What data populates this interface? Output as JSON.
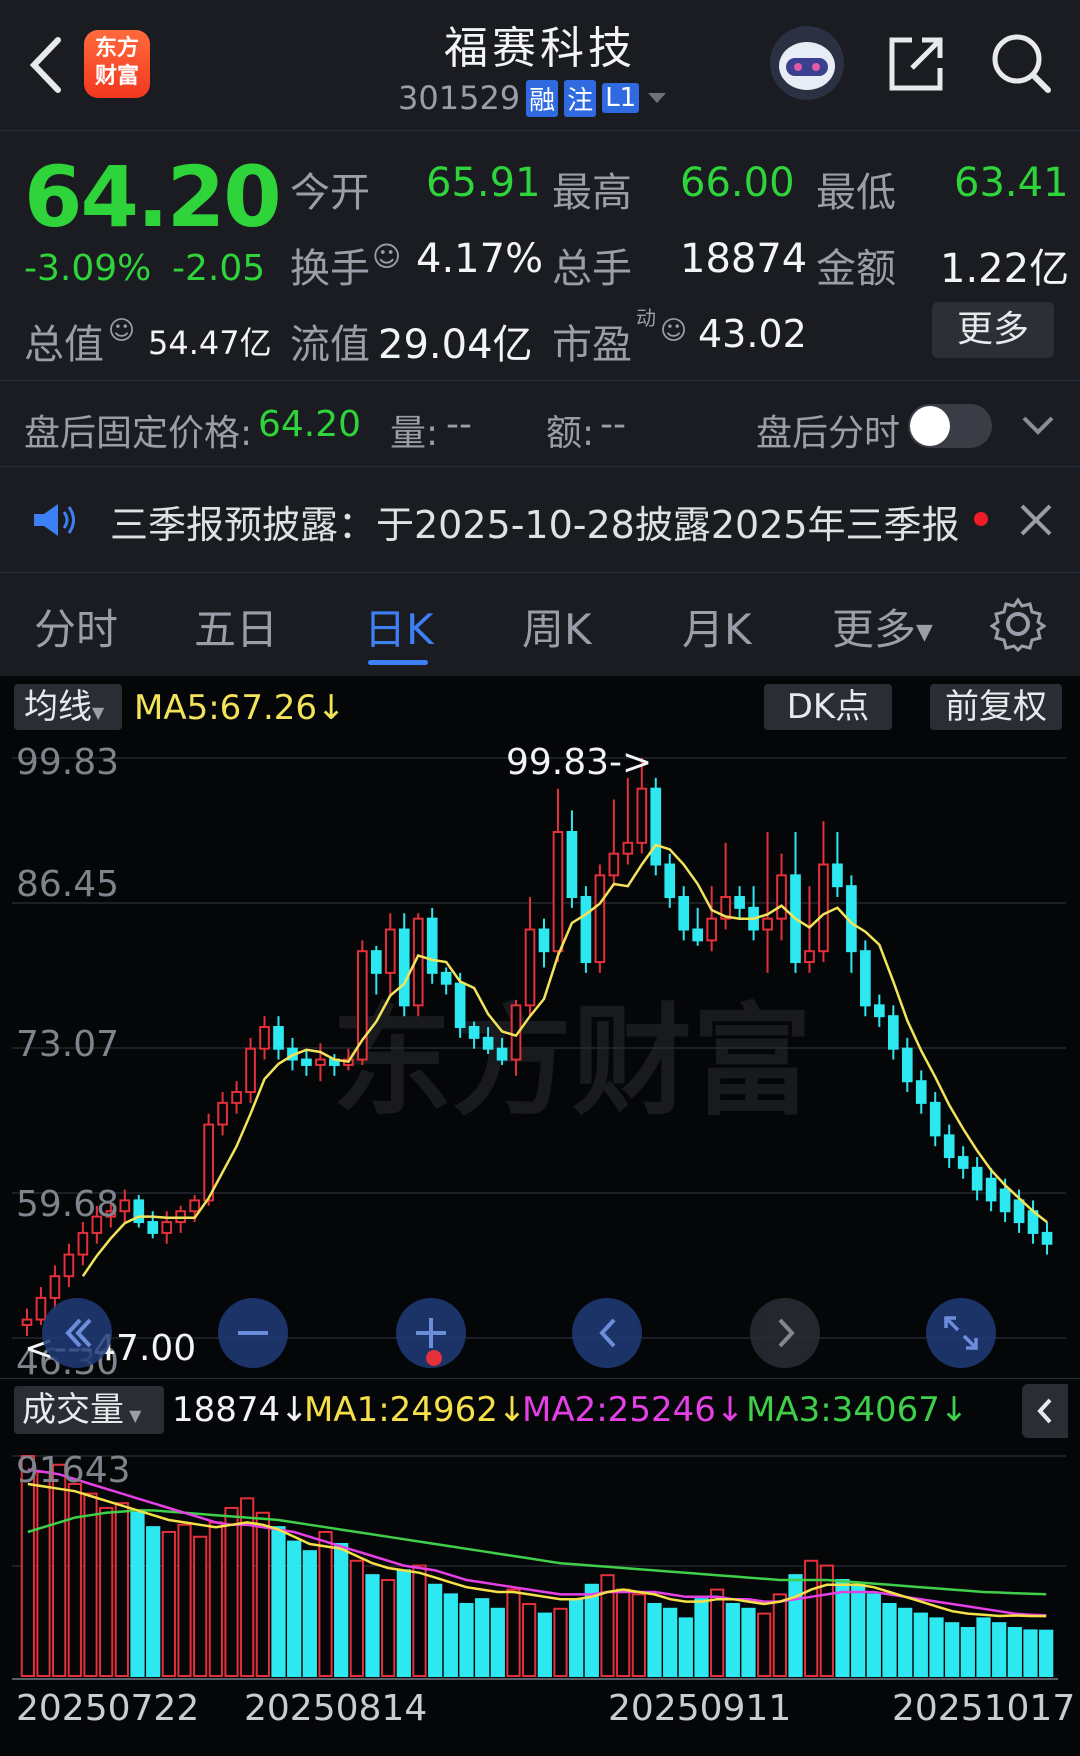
{
  "header": {
    "back_icon": "chevron-left-icon",
    "app_logo_text": [
      "东方",
      "财富"
    ],
    "stock_name": "福赛科技",
    "stock_code": "301529",
    "badges": [
      "融",
      "注",
      "L1"
    ],
    "robot_icon": "robot-avatar-icon",
    "share_icon": "share-icon",
    "search_icon": "search-icon"
  },
  "quote": {
    "price": "64.20",
    "change_pct": "-3.09%",
    "change": "-2.05",
    "fields": [
      {
        "label": "今开",
        "value": "65.91"
      },
      {
        "label": "最高",
        "value": "66.00"
      },
      {
        "label": "最低",
        "value": "63.41"
      },
      {
        "label": "换手",
        "value": "4.17%"
      },
      {
        "label": "总手",
        "value": "18874"
      },
      {
        "label": "金额",
        "value": "1.22亿"
      },
      {
        "label": "总值",
        "value": "54.47亿"
      },
      {
        "label": "流值",
        "value": "29.04亿"
      },
      {
        "label": "市盈",
        "sup": "动",
        "value": "43.02"
      }
    ],
    "more_button": "更多"
  },
  "after_hours": {
    "price_label": "盘后固定价格:",
    "price_value": "64.20",
    "volume_label": "量:",
    "volume_value": "--",
    "amount_label": "额:",
    "amount_value": "--",
    "toggle_label": "盘后分时"
  },
  "notice": {
    "text": "三季报预披露：于2025-10-28披露2025年三季报"
  },
  "tabs": [
    "分时",
    "五日",
    "日K",
    "周K",
    "月K",
    "更多"
  ],
  "active_tab": "日K",
  "kline": {
    "indicator_select": "均线",
    "ma5_text": "MA5:67.26↓",
    "dk_button": "DK点",
    "adjust_button": "前复权",
    "watermark": "东方财富",
    "y_ticks": [
      "99.83",
      "86.45",
      "73.07",
      "59.68",
      "46.30"
    ],
    "high_mark": "99.83->",
    "low_mark": "<---47.00"
  },
  "volume": {
    "select": "成交量",
    "value_text": "18874↓",
    "ma1_text": "MA1:24962↓",
    "ma2_text": "MA2:25246↓",
    "ma3_text": "MA3:34067↓",
    "max_tick": "91643",
    "colors": {
      "ma1": "#f5e04a",
      "ma2": "#e440e6",
      "ma3": "#3fcf4a"
    }
  },
  "x_dates": [
    "20250722",
    "20250814",
    "20250911",
    "20251017"
  ],
  "colors": {
    "up": "#e3303a",
    "down": "#2de8f0",
    "ma5": "#f3e35a",
    "green": "#2fd43b",
    "bg": "#1a1c21",
    "chart_bg": "#020305"
  },
  "chart_data": [
    {
      "type": "candlestick",
      "ylim": [
        46.3,
        99.83
      ],
      "candles": [
        [
          47.5,
          48,
          49,
          46.5
        ],
        [
          48,
          50,
          51,
          47.5
        ],
        [
          50,
          52,
          53,
          49
        ],
        [
          52,
          54,
          55,
          51
        ],
        [
          54,
          56,
          57,
          53
        ],
        [
          56,
          57.5,
          58.5,
          55
        ],
        [
          57.5,
          58,
          59,
          56.5
        ],
        [
          58,
          59,
          60,
          57
        ],
        [
          59,
          57,
          59.5,
          56.5
        ],
        [
          57,
          56,
          58,
          55.5
        ],
        [
          56,
          57,
          58,
          55
        ],
        [
          57,
          58,
          58.5,
          56
        ],
        [
          58,
          59,
          59.5,
          57
        ],
        [
          59,
          66,
          67,
          58.5
        ],
        [
          66,
          68,
          69,
          65
        ],
        [
          68,
          69,
          70,
          67
        ],
        [
          69,
          73,
          74,
          68
        ],
        [
          73,
          75,
          76,
          72
        ],
        [
          75,
          73,
          76,
          72
        ],
        [
          73,
          72,
          74,
          71
        ],
        [
          72,
          71.5,
          73,
          70.5
        ],
        [
          71.5,
          72,
          73.5,
          70
        ],
        [
          72,
          71.5,
          72.5,
          70.5
        ],
        [
          71.5,
          72,
          73,
          71
        ],
        [
          72,
          82,
          83,
          71.5
        ],
        [
          82,
          80,
          82.5,
          78
        ],
        [
          80,
          84,
          85.5,
          78
        ],
        [
          84,
          77,
          85.5,
          76
        ],
        [
          77,
          85,
          85.5,
          76
        ],
        [
          85,
          80,
          86,
          79
        ],
        [
          80,
          79,
          80.5,
          78
        ],
        [
          79,
          75,
          80,
          74
        ],
        [
          75,
          74,
          75.5,
          73
        ],
        [
          74,
          73,
          75,
          72.5
        ],
        [
          73,
          72,
          74,
          71.5
        ],
        [
          72,
          77,
          77.5,
          70.5
        ],
        [
          77,
          84,
          87,
          76
        ],
        [
          84,
          82,
          85,
          80.5
        ],
        [
          82,
          93,
          97,
          81
        ],
        [
          93,
          87,
          95,
          86
        ],
        [
          87,
          81,
          88,
          80
        ],
        [
          81,
          89,
          90,
          80
        ],
        [
          89,
          91,
          96,
          88
        ],
        [
          91,
          92,
          98,
          90
        ],
        [
          92,
          97,
          99.83,
          91
        ],
        [
          97,
          90,
          98,
          89
        ],
        [
          90,
          87,
          91,
          86
        ],
        [
          87,
          84,
          88,
          83
        ],
        [
          84,
          83,
          86,
          82.5
        ],
        [
          83,
          85,
          88,
          82
        ],
        [
          85,
          87,
          92,
          84
        ],
        [
          87,
          86,
          88,
          85
        ],
        [
          86,
          84,
          88,
          83
        ],
        [
          84,
          85,
          93,
          80
        ],
        [
          85,
          89,
          91,
          83
        ],
        [
          89,
          81,
          93,
          80
        ],
        [
          81,
          82,
          88,
          80
        ],
        [
          82,
          90,
          94,
          81
        ],
        [
          90,
          88,
          93,
          87
        ],
        [
          88,
          82,
          89,
          80
        ],
        [
          82,
          77,
          83,
          76
        ],
        [
          77,
          76,
          78,
          75
        ],
        [
          76,
          73,
          77,
          72
        ],
        [
          73,
          70,
          74,
          69
        ],
        [
          70,
          68,
          71,
          67
        ],
        [
          68,
          65,
          69,
          64
        ],
        [
          65,
          63,
          66,
          62
        ],
        [
          63,
          62,
          64,
          61
        ],
        [
          62,
          60,
          63,
          59
        ],
        [
          61,
          59,
          62,
          58
        ],
        [
          60,
          58,
          61,
          57
        ],
        [
          59,
          57,
          60,
          56
        ],
        [
          58,
          56,
          59,
          55
        ],
        [
          56,
          55,
          57,
          54
        ]
      ],
      "ma5_label": "MA5:67.26↓"
    },
    {
      "type": "bar",
      "name": "成交量",
      "max": 91643,
      "values": [
        91643,
        85000,
        88000,
        80000,
        76000,
        70000,
        72000,
        68000,
        62000,
        60000,
        63000,
        58000,
        64000,
        70000,
        74000,
        68000,
        62000,
        56000,
        52000,
        60000,
        55000,
        48000,
        42000,
        40000,
        44000,
        46000,
        38000,
        34000,
        30000,
        32000,
        28000,
        36000,
        30000,
        26000,
        28000,
        32000,
        38000,
        42000,
        36000,
        34000,
        30000,
        28000,
        24000,
        32000,
        36000,
        30000,
        28000,
        26000,
        34000,
        42000,
        48000,
        46000,
        40000,
        38000,
        34000,
        30000,
        28000,
        26000,
        24000,
        22000,
        20000,
        24000,
        22000,
        20000,
        19000,
        18874
      ],
      "ma1": [
        80000,
        79000,
        78000,
        77000,
        75000,
        73000,
        71000,
        69000,
        67000,
        65000,
        64000,
        63000,
        62000,
        63000,
        64000,
        63000,
        61000,
        58000,
        55000,
        54000,
        53000,
        50000,
        47000,
        45000,
        44000,
        43000,
        41000,
        39000,
        37000,
        36000,
        35000,
        35000,
        34000,
        33000,
        32000,
        32000,
        33000,
        35000,
        36000,
        35000,
        34000,
        32000,
        31000,
        31000,
        32000,
        32000,
        31000,
        30000,
        31000,
        33000,
        36000,
        38000,
        38000,
        38000,
        37000,
        35000,
        33000,
        31000,
        29000,
        27000,
        26000,
        25500,
        25000,
        25200,
        25000,
        24962
      ],
      "ma2": [
        86000,
        85000,
        84000,
        82000,
        80000,
        78000,
        76000,
        74000,
        72000,
        70000,
        68000,
        66000,
        64000,
        63000,
        63000,
        62000,
        61000,
        60000,
        58000,
        56000,
        54000,
        52000,
        50000,
        48000,
        46000,
        45000,
        44000,
        42000,
        40000,
        39000,
        38000,
        37000,
        36000,
        35000,
        34000,
        34000,
        34000,
        35000,
        35000,
        35000,
        35000,
        34000,
        33000,
        33000,
        33000,
        32000,
        32000,
        31000,
        31000,
        32000,
        33000,
        34000,
        35000,
        35000,
        35000,
        34000,
        33000,
        32000,
        31000,
        30000,
        29000,
        28000,
        27000,
        26000,
        25500,
        25246
      ],
      "ma3": [
        60000,
        62000,
        64000,
        66000,
        67000,
        68000,
        68500,
        69000,
        69000,
        68500,
        68000,
        67500,
        67000,
        66500,
        66000,
        65500,
        65000,
        64000,
        63000,
        62000,
        61000,
        60000,
        59000,
        58000,
        57000,
        56000,
        55000,
        54000,
        53000,
        52000,
        51000,
        50000,
        49000,
        48000,
        47000,
        46500,
        46000,
        45500,
        45000,
        44500,
        44000,
        43500,
        43000,
        42500,
        42000,
        41500,
        41000,
        40500,
        40000,
        40000,
        40000,
        40000,
        39500,
        39000,
        38500,
        38000,
        37500,
        37000,
        36500,
        36000,
        35500,
        35000,
        34800,
        34500,
        34300,
        34067
      ]
    }
  ]
}
